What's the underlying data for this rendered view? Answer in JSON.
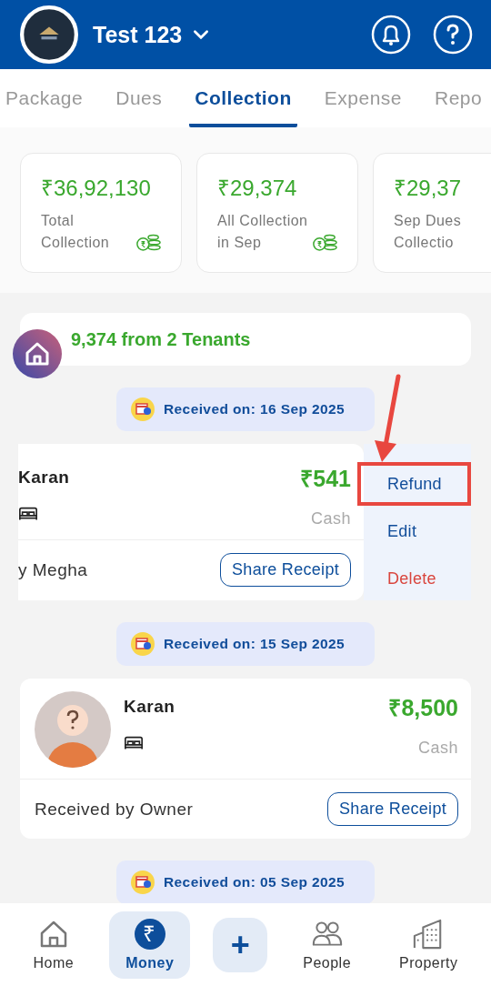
{
  "header": {
    "title": "Test 123"
  },
  "tabs": [
    {
      "label": "Package",
      "selected": false
    },
    {
      "label": "Dues",
      "selected": false
    },
    {
      "label": "Collection",
      "selected": true
    },
    {
      "label": "Expense",
      "selected": false
    },
    {
      "label": "Repo",
      "selected": false
    }
  ],
  "stats": [
    {
      "amount": "₹36,92,130",
      "label_lines": [
        "Total",
        "Collection"
      ],
      "coins_icon": true
    },
    {
      "amount": "₹29,374",
      "label_lines": [
        "All Collection",
        "in Sep"
      ],
      "coins_icon": true
    },
    {
      "amount": "₹29,37",
      "label_lines": [
        "Sep Dues",
        "Collectio"
      ]
    }
  ],
  "summary": "9,374 from 2 Tenants",
  "groups": [
    {
      "date": "Received on: 16 Sep 2025",
      "card": {
        "kind": "swiped",
        "name": "Karan",
        "amount": "₹541",
        "method": "Cash",
        "received_by": "y Megha",
        "button": "Share Receipt",
        "actions": [
          {
            "label": "Refund",
            "kind": "normal",
            "highlighted": true
          },
          {
            "label": "Edit",
            "kind": "normal",
            "highlighted": false
          },
          {
            "label": "Delete",
            "kind": "danger",
            "highlighted": false
          }
        ]
      }
    },
    {
      "date": "Received on: 15 Sep 2025",
      "card": {
        "kind": "full",
        "name": "Karan",
        "amount": "₹8,500",
        "method": "Cash",
        "received_by": "Received by Owner",
        "button": "Share Receipt"
      }
    },
    {
      "date": "Received on: 05 Sep 2025"
    }
  ],
  "nav": [
    {
      "label": "Home",
      "kind": "home",
      "selected": false
    },
    {
      "label": "Money",
      "kind": "money",
      "glyph": "₹",
      "selected": true
    },
    {
      "kind": "add",
      "glyph": "+"
    },
    {
      "label": "People",
      "kind": "people",
      "selected": false
    },
    {
      "label": "Property",
      "kind": "property",
      "selected": false
    }
  ]
}
